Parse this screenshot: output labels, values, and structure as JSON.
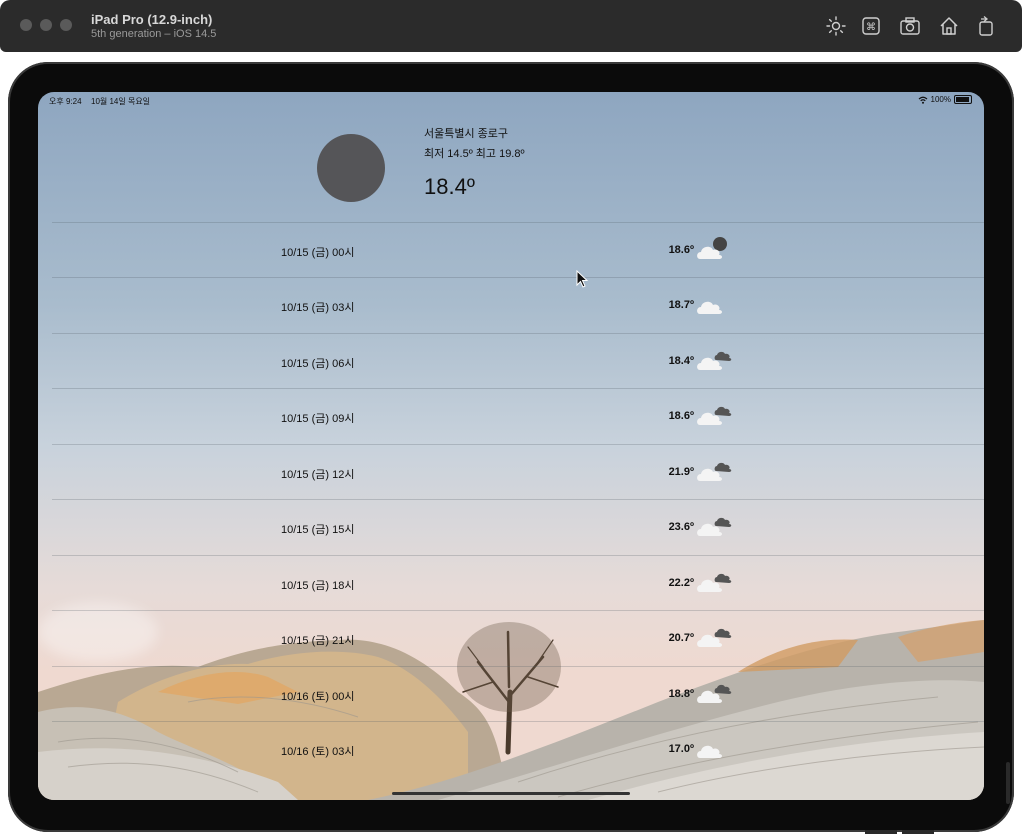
{
  "simulator": {
    "device_name": "iPad Pro (12.9-inch)",
    "device_detail": "5th generation – iOS 14.5",
    "toolbar_icons": [
      "brightness-icon",
      "command-icon",
      "screenshot-icon",
      "home-icon",
      "rotate-icon"
    ]
  },
  "status_bar": {
    "time": "오후 9:24",
    "date": "10월 14일 목요일",
    "battery": "100%"
  },
  "current": {
    "location": "서울특별시 종로구",
    "min_max": "최저 14.5º 최고 19.8º",
    "temperature": "18.4º"
  },
  "forecast": [
    {
      "time": "10/15 (금) 00시",
      "temp": "18.6º",
      "icon": "cloud-moon-icon"
    },
    {
      "time": "10/15 (금) 03시",
      "temp": "18.7º",
      "icon": "cloud-icon"
    },
    {
      "time": "10/15 (금) 06시",
      "temp": "18.4º",
      "icon": "clouds-icon"
    },
    {
      "time": "10/15 (금) 09시",
      "temp": "18.6º",
      "icon": "clouds-icon"
    },
    {
      "time": "10/15 (금) 12시",
      "temp": "21.9º",
      "icon": "clouds-icon"
    },
    {
      "time": "10/15 (금) 15시",
      "temp": "23.6º",
      "icon": "clouds-icon"
    },
    {
      "time": "10/15 (금) 18시",
      "temp": "22.2º",
      "icon": "clouds-icon"
    },
    {
      "time": "10/15 (금) 21시",
      "temp": "20.7º",
      "icon": "clouds-icon"
    },
    {
      "time": "10/16 (토) 00시",
      "temp": "18.8º",
      "icon": "clouds-icon"
    },
    {
      "time": "10/16 (토) 03시",
      "temp": "17.0º",
      "icon": "cloud-icon"
    }
  ],
  "colors": {
    "toolbar_bg": "#2b2b2b",
    "device_frame": "#0b0b0b",
    "current_icon_placeholder": "#555558",
    "text": "#111111"
  }
}
